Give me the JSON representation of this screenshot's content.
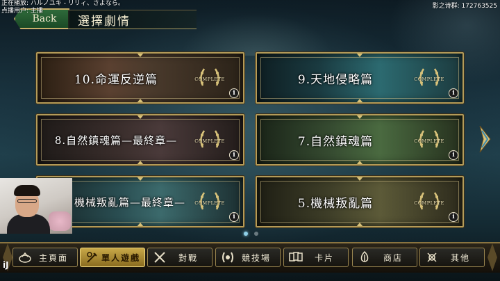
{
  "stream_overlay": {
    "now_playing": "正在播放: ハルノユキ - リリィ、さよなら。",
    "requester": "点播用户: 主播",
    "group_label": "影之诗群: 172763525",
    "logo": "iJ"
  },
  "header": {
    "back_label": "Back",
    "title": "選擇劇情"
  },
  "stories": [
    {
      "label": "10.命運反逆篇",
      "badge": "COMPLETE",
      "info": "i"
    },
    {
      "label": "9.天地侵略篇",
      "badge": "COMPLETE",
      "info": "i"
    },
    {
      "label": "8.自然鎮魂篇—最終章—",
      "badge": "COMPLETE",
      "info": "i"
    },
    {
      "label": "7.自然鎮魂篇",
      "badge": "COMPLETE",
      "info": "i"
    },
    {
      "label": "機械叛亂篇—最終章—",
      "badge": "COMPLETE",
      "info": "i"
    },
    {
      "label": "5.機械叛亂篇",
      "badge": "COMPLETE",
      "info": "i"
    }
  ],
  "pager": {
    "current": 1,
    "total": 2
  },
  "nav": {
    "items": [
      {
        "label": "主頁面",
        "icon": "home-icon"
      },
      {
        "label": "單人遊戲",
        "icon": "solo-play-icon"
      },
      {
        "label": "對戰",
        "icon": "crossed-swords-icon"
      },
      {
        "label": "競技場",
        "icon": "laurel-arena-icon"
      },
      {
        "label": "卡片",
        "icon": "cards-icon"
      },
      {
        "label": "商店",
        "icon": "shop-icon"
      },
      {
        "label": "其他",
        "icon": "other-icon"
      }
    ],
    "active_index": 1
  },
  "colors": {
    "gold_border": "#b49b58",
    "accent_cyan": "#8fd0e8",
    "back_green": "#2e6a3a"
  }
}
